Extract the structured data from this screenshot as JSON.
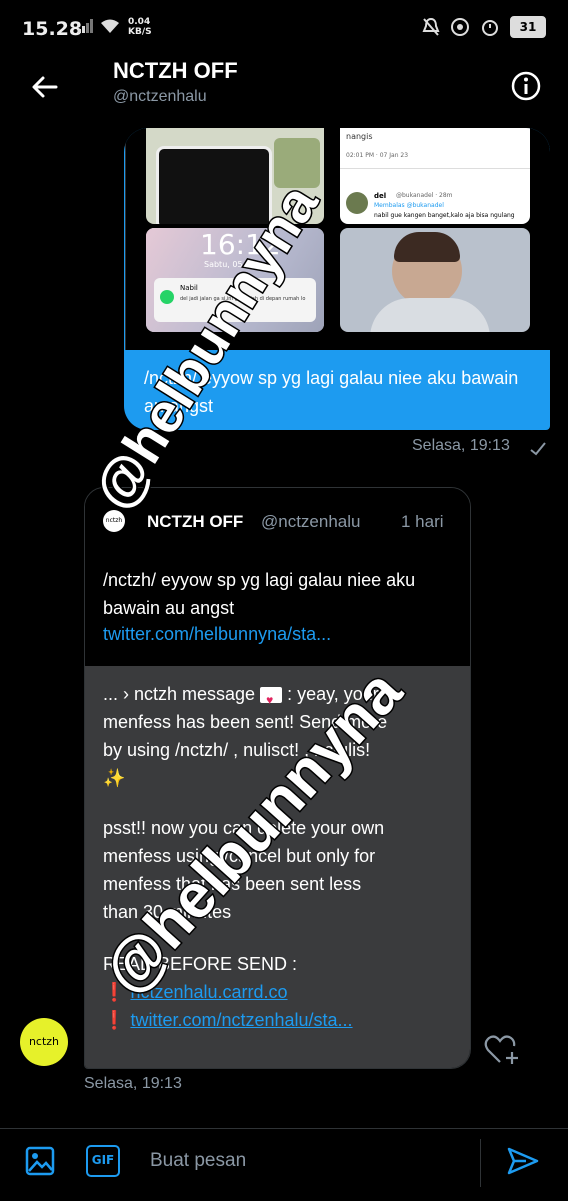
{
  "status_bar": {
    "time": "15.28",
    "speed_value": "0.04",
    "speed_unit": "KB/S",
    "battery": "31"
  },
  "header": {
    "title": "NCTZH OFF",
    "handle": "@nctzenhalu"
  },
  "sent_message": {
    "image_texts": {
      "clock": "16:12",
      "date": "Sabtu, 05 Juni",
      "notif_name": "Nabil",
      "notif_text": "del jadi jalan ga si,ini gue udah di depan rumah lo",
      "tweet_time": "02:01 PM · 07 Jan 23",
      "reply_name": "del",
      "reply_handle": "@bukanadel · 28m",
      "reply_to": "Membalas @bukanadel",
      "reply_text": "nabil gue kangen banget,kalo aja bisa ngulang",
      "tweet_text": "nangis"
    },
    "text": "/nctzh/ eyyow sp yg lagi galau niee aku bawain au angst",
    "time": "Selasa, 19:13"
  },
  "received_message": {
    "quote": {
      "avatar_text": "nctzh",
      "name": "NCTZH OFF",
      "handle": "@nctzenhalu",
      "age": "1 hari",
      "text": "/nctzh/ eyyow sp yg lagi galau niee aku bawain au angst",
      "link": "twitter.com/helbunnyna/sta..."
    },
    "body": {
      "line1a": "... › nctzh message ",
      "line1b": " : yeay, your",
      "line2": "menfess has been sent! Send more",
      "line3": "by using /nctzh/ , nulisct! , nctulis!",
      "sparkle": "✨",
      "line5": "psst!! now you can delete your own",
      "line6": "menfess using /cancel but only for",
      "line7": "menfess that has been sent less",
      "line8": "than 30 minutes",
      "line10": "READ BEFORE SEND :",
      "mark": "❗",
      "link1": "nctzenhalu.carrd.co",
      "link2": "twitter.com/nctzenhalu/sta..."
    },
    "avatar_text": "nctzh",
    "time": "Selasa, 19:13"
  },
  "composer": {
    "placeholder": "Buat pesan",
    "gif_label": "GIF"
  },
  "watermark": "@helbunnyna",
  "colors": {
    "accent": "#1d9bf0",
    "bubble_received": "#3a3b3d",
    "avatar_bg": "#e6f12a"
  }
}
